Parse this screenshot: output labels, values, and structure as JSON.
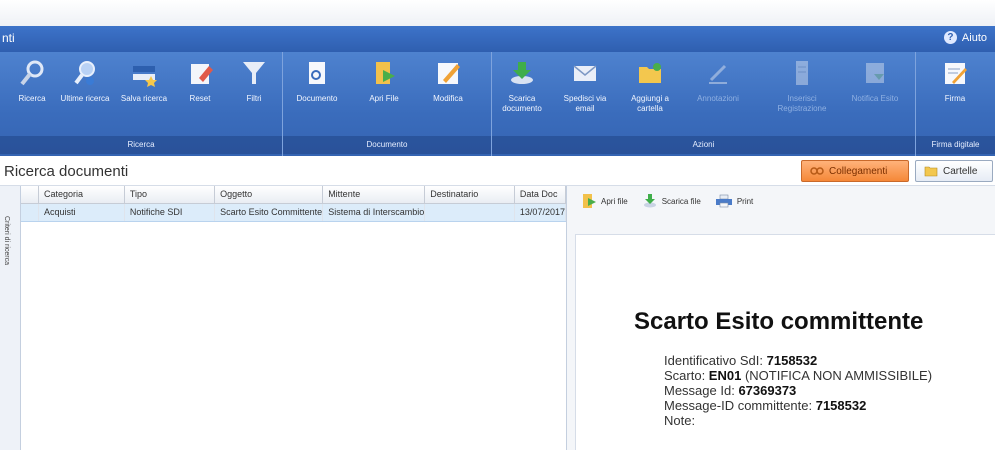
{
  "app": {
    "title": "nti",
    "help_label": "Aiuto"
  },
  "ribbon": {
    "groups": [
      {
        "title": "Ricerca",
        "buttons": [
          {
            "label": "Ricerca",
            "icon": "magnifier-icon",
            "enabled": true
          },
          {
            "label": "Ultime ricerca",
            "icon": "recent-search-icon",
            "enabled": true
          },
          {
            "label": "Salva ricerca",
            "icon": "save-search-icon",
            "enabled": true
          },
          {
            "label": "Reset",
            "icon": "eraser-icon",
            "enabled": true
          },
          {
            "label": "Filtri",
            "icon": "funnel-icon",
            "enabled": true
          }
        ]
      },
      {
        "title": "Documento",
        "buttons": [
          {
            "label": "Documento",
            "icon": "document-search-icon",
            "enabled": true
          },
          {
            "label": "Apri File",
            "icon": "open-file-icon",
            "enabled": true
          },
          {
            "label": "Modifica",
            "icon": "edit-pencil-icon",
            "enabled": true
          }
        ]
      },
      {
        "title": "Azioni",
        "buttons": [
          {
            "label": "Scarica documento",
            "icon": "download-icon",
            "enabled": true
          },
          {
            "label": "Spedisci via email",
            "icon": "envelope-icon",
            "enabled": true
          },
          {
            "label": "Aggiungi a cartella",
            "icon": "folder-add-icon",
            "enabled": true
          },
          {
            "label": "Annotazioni",
            "icon": "annotation-icon",
            "enabled": false
          },
          {
            "label": "Inserisci Registrazione",
            "icon": "register-icon",
            "enabled": false
          },
          {
            "label": "Notifica Esito",
            "icon": "notify-icon",
            "enabled": false
          }
        ]
      },
      {
        "title": "Firma digitale",
        "buttons": [
          {
            "label": "Firma",
            "icon": "signature-icon",
            "enabled": true
          }
        ]
      }
    ]
  },
  "page": {
    "title": "Ricerca documenti",
    "tabs": {
      "collegamenti": "Collegamenti",
      "cartelle": "Cartelle"
    },
    "sidebar_label": "Criteri di ricerca"
  },
  "grid": {
    "columns": [
      "Categoria",
      "Tipo",
      "Oggetto",
      "Mittente",
      "Destinatario",
      "Data Doc"
    ],
    "rows": [
      [
        "Acquisti",
        "Notifiche SDI",
        "Scarto Esito Committente",
        "Sistema di Interscambio",
        "",
        "13/07/2017"
      ]
    ]
  },
  "preview": {
    "toolbar": {
      "open": "Apri file",
      "download": "Scarica file",
      "print": "Print"
    },
    "doc": {
      "heading": "Scarto Esito committente",
      "sdi_label": "Identificativo SdI: ",
      "sdi_value": "7158532",
      "scarto_label": "Scarto: ",
      "scarto_code": "EN01",
      "scarto_desc": " (NOTIFICA NON AMMISSIBILE)",
      "msg_label": "Message Id: ",
      "msg_value": "67369373",
      "msg_comm_label": "Message-ID committente: ",
      "msg_comm_value": "7158532",
      "note_label": "Note:"
    }
  },
  "colors": {
    "ribbon": "#3a6cbc",
    "accent_tab": "#f58838",
    "row_selected": "#dcecfa"
  }
}
